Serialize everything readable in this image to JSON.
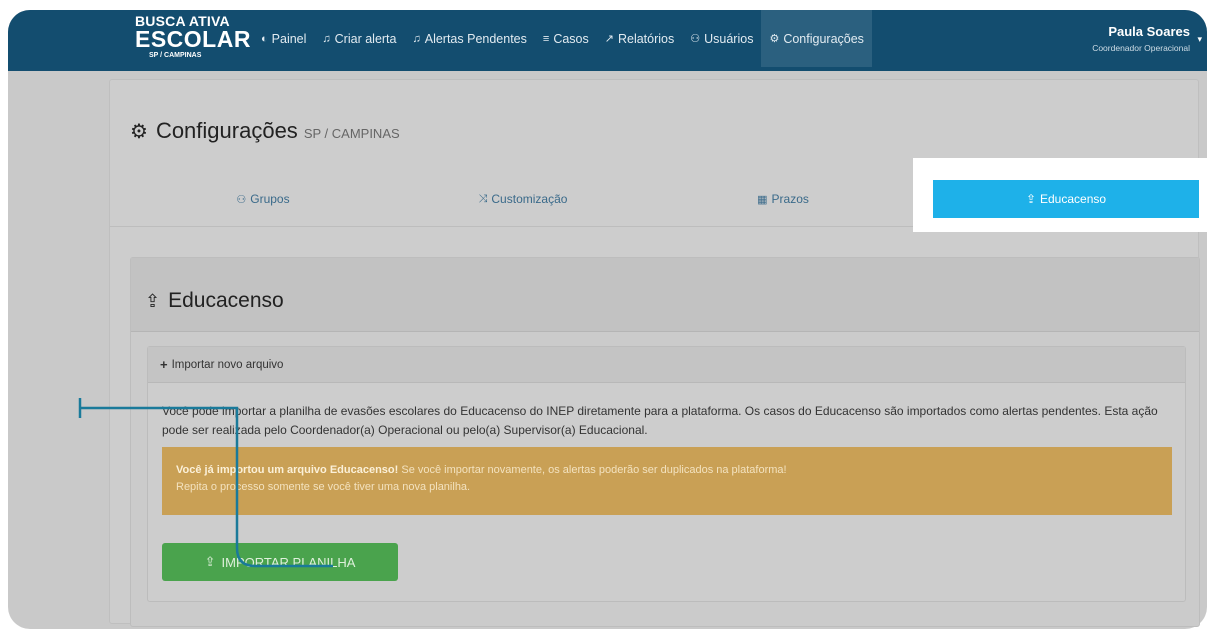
{
  "brand": {
    "line1": "BUSCA ATIVA",
    "line2": "ESCOLAR",
    "line3": "SP / CAMPINAS"
  },
  "nav": {
    "items": [
      {
        "icon": "dashboard-icon",
        "glyph": "◐",
        "label": "Painel"
      },
      {
        "icon": "bell-icon",
        "glyph": "♫",
        "label": "Criar alerta"
      },
      {
        "icon": "bell-icon",
        "glyph": "♫",
        "label": "Alertas Pendentes"
      },
      {
        "icon": "list-icon",
        "glyph": "≡",
        "label": "Casos"
      },
      {
        "icon": "line-chart-icon",
        "glyph": "↗",
        "label": "Relatórios"
      },
      {
        "icon": "users-icon",
        "glyph": "⚇",
        "label": "Usuários"
      },
      {
        "icon": "gear-icon",
        "glyph": "⚙",
        "label": "Configurações",
        "active": true
      }
    ]
  },
  "user": {
    "name": "Paula Soares",
    "role": "Coordenador Operacional"
  },
  "page": {
    "title": "Configurações",
    "subtitle": "SP / CAMPINAS"
  },
  "tabs": [
    {
      "label": "Grupos",
      "icon": "users-icon",
      "glyph": "⚇"
    },
    {
      "label": "Customização",
      "icon": "shuffle-icon",
      "glyph": "⤨"
    },
    {
      "label": "Prazos",
      "icon": "calendar-icon",
      "glyph": "▦"
    },
    {
      "label": "Educacenso",
      "icon": "upload-icon",
      "glyph": "⇪",
      "active": true
    }
  ],
  "section": {
    "title": "Educacenso",
    "icon": "upload-icon"
  },
  "import_box": {
    "header": "Importar novo arquivo",
    "description": "Você pode importar a planilha de evasões escolares do Educacenso do INEP diretamente para a plataforma. Os casos do Educacenso são importados como alertas pendentes. Esta ação pode ser realizada pelo Coordenador(a) Operacional ou pelo(a) Supervisor(a) Educacional.",
    "warning_bold": "Você já importou um arquivo Educacenso!",
    "warning_text": "Se você importar novamente, os alertas poderão ser duplicados na plataforma!",
    "warning_line2": "Repita o processo somente se você tiver uma nova planilha.",
    "button_label": "IMPORTAR PLANILHA"
  },
  "colors": {
    "navbar": "#134d6f",
    "active_tab": "#1eb1e9",
    "warning": "#c9a055",
    "button": "#4aa34d",
    "annotation": "#1a7a9a"
  }
}
